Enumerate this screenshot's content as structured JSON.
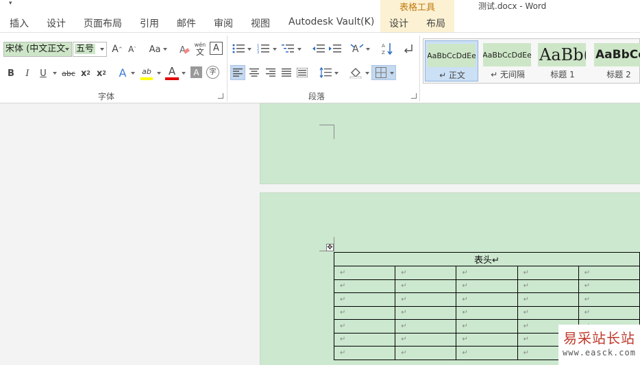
{
  "title_bar": {
    "qat_symbol": "▾",
    "context_title": "表格工具",
    "doc_title": "测试.docx - Word"
  },
  "tabs": [
    "插入",
    "设计",
    "页面布局",
    "引用",
    "邮件",
    "审阅",
    "视图",
    "Autodesk Vault(K)",
    "设计",
    "布局"
  ],
  "font_group": {
    "font_name": "宋体 (中文正文",
    "font_size": "五号",
    "label": "字体",
    "grow_icon": "A",
    "shrink_icon": "A",
    "case_label": "Aa",
    "phonetic_top": "wén",
    "phonetic_bottom": "文",
    "border_char": "A",
    "bold": "B",
    "italic": "I",
    "underline": "U",
    "strike": "abc",
    "subscript": "x",
    "superscript": "x",
    "sub_mark": "2",
    "sup_mark": "2",
    "effects": "A",
    "highlight": "ab",
    "font_color": "A",
    "shading": "A",
    "enclose": "字"
  },
  "paragraph_group": {
    "label": "段落"
  },
  "styles": [
    {
      "preview": "AaBbCcDdEe",
      "name": "↵ 正文",
      "active": true
    },
    {
      "preview": "AaBbCcDdEe",
      "name": "↵ 无间隔",
      "active": false
    },
    {
      "preview": "AaBb(",
      "name": "标题 1",
      "active": false
    },
    {
      "preview": "AaBbCc",
      "name": "标题 2",
      "active": false
    }
  ],
  "table": {
    "handle_symbol": "✥",
    "header": "表头↵",
    "cell_mark": "↵",
    "rows": 7,
    "cols": 5
  },
  "watermark": {
    "text": "易采站长站",
    "url": "www.easck.com"
  },
  "colors": {
    "page_bg": "#cce8cf",
    "context_tab": "#c07a10",
    "highlight_yellow": "#ffff00",
    "font_red": "#e00000",
    "active_btn": "#c5d9ef"
  }
}
